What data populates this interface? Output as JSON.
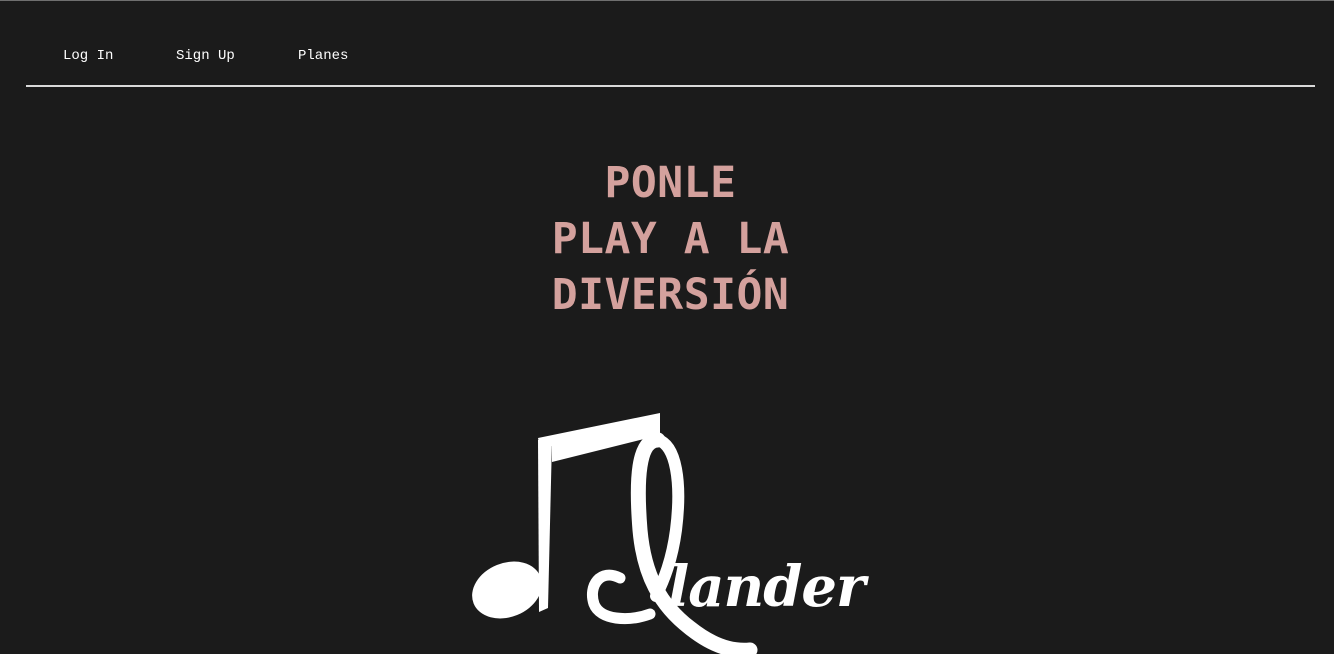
{
  "nav": {
    "items": [
      {
        "label": "Log In"
      },
      {
        "label": "Sign Up"
      },
      {
        "label": "Planes"
      }
    ]
  },
  "hero": {
    "lines": [
      "PONLE",
      "PLAY A LA",
      "DIVERSIÓN"
    ]
  },
  "logo": {
    "text": "lander",
    "icon": "music-note-icon"
  },
  "colors": {
    "background": "#1b1b1b",
    "nav_text": "#ffffff",
    "divider": "#d9d9d9",
    "hero_text": "#d4a19d",
    "logo": "#ffffff"
  }
}
